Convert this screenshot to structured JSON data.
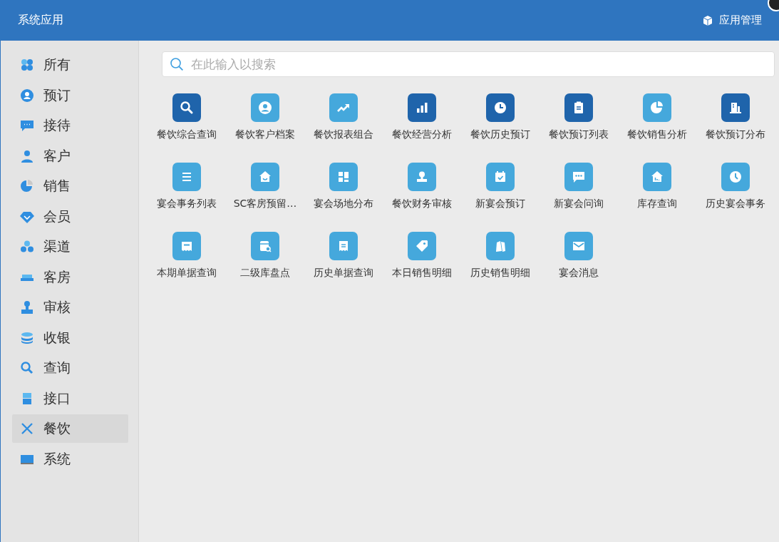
{
  "window": {
    "title": "系统应用",
    "manage_label": "应用管理"
  },
  "sidebar": {
    "items": [
      {
        "label": "所有",
        "selected": false
      },
      {
        "label": "预订",
        "selected": false
      },
      {
        "label": "接待",
        "selected": false
      },
      {
        "label": "客户",
        "selected": false
      },
      {
        "label": "销售",
        "selected": false
      },
      {
        "label": "会员",
        "selected": false
      },
      {
        "label": "渠道",
        "selected": false
      },
      {
        "label": "客房",
        "selected": false
      },
      {
        "label": "审核",
        "selected": false
      },
      {
        "label": "收银",
        "selected": false
      },
      {
        "label": "查询",
        "selected": false
      },
      {
        "label": "接口",
        "selected": false
      },
      {
        "label": "餐饮",
        "selected": true
      },
      {
        "label": "系统",
        "selected": false
      }
    ]
  },
  "search": {
    "placeholder": "在此输入以搜索"
  },
  "apps": [
    {
      "label": "餐饮综合查询",
      "color": "#1f64ab"
    },
    {
      "label": "餐饮客户档案",
      "color": "#45a8dc"
    },
    {
      "label": "餐饮报表组合",
      "color": "#45a8dc"
    },
    {
      "label": "餐饮经营分析",
      "color": "#1f64ab"
    },
    {
      "label": "餐饮历史预订",
      "color": "#1f64ab"
    },
    {
      "label": "餐饮预订列表",
      "color": "#1f64ab"
    },
    {
      "label": "餐饮销售分析",
      "color": "#45a8dc"
    },
    {
      "label": "餐饮预订分布",
      "color": "#1f64ab"
    },
    {
      "label": "宴会事务列表",
      "color": "#45a8dc"
    },
    {
      "label": "SC客房预留…",
      "color": "#45a8dc"
    },
    {
      "label": "宴会场地分布",
      "color": "#45a8dc"
    },
    {
      "label": "餐饮财务审核",
      "color": "#45a8dc"
    },
    {
      "label": "新宴会预订",
      "color": "#45a8dc"
    },
    {
      "label": "新宴会问询",
      "color": "#45a8dc"
    },
    {
      "label": "库存查询",
      "color": "#45a8dc"
    },
    {
      "label": "历史宴会事务",
      "color": "#45a8dc"
    },
    {
      "label": "本期单据查询",
      "color": "#45a8dc"
    },
    {
      "label": "二级库盘点",
      "color": "#45a8dc"
    },
    {
      "label": "历史单据查询",
      "color": "#45a8dc"
    },
    {
      "label": "本日销售明细",
      "color": "#45a8dc"
    },
    {
      "label": "历史销售明细",
      "color": "#45a8dc"
    },
    {
      "label": "宴会消息",
      "color": "#45a8dc"
    }
  ]
}
